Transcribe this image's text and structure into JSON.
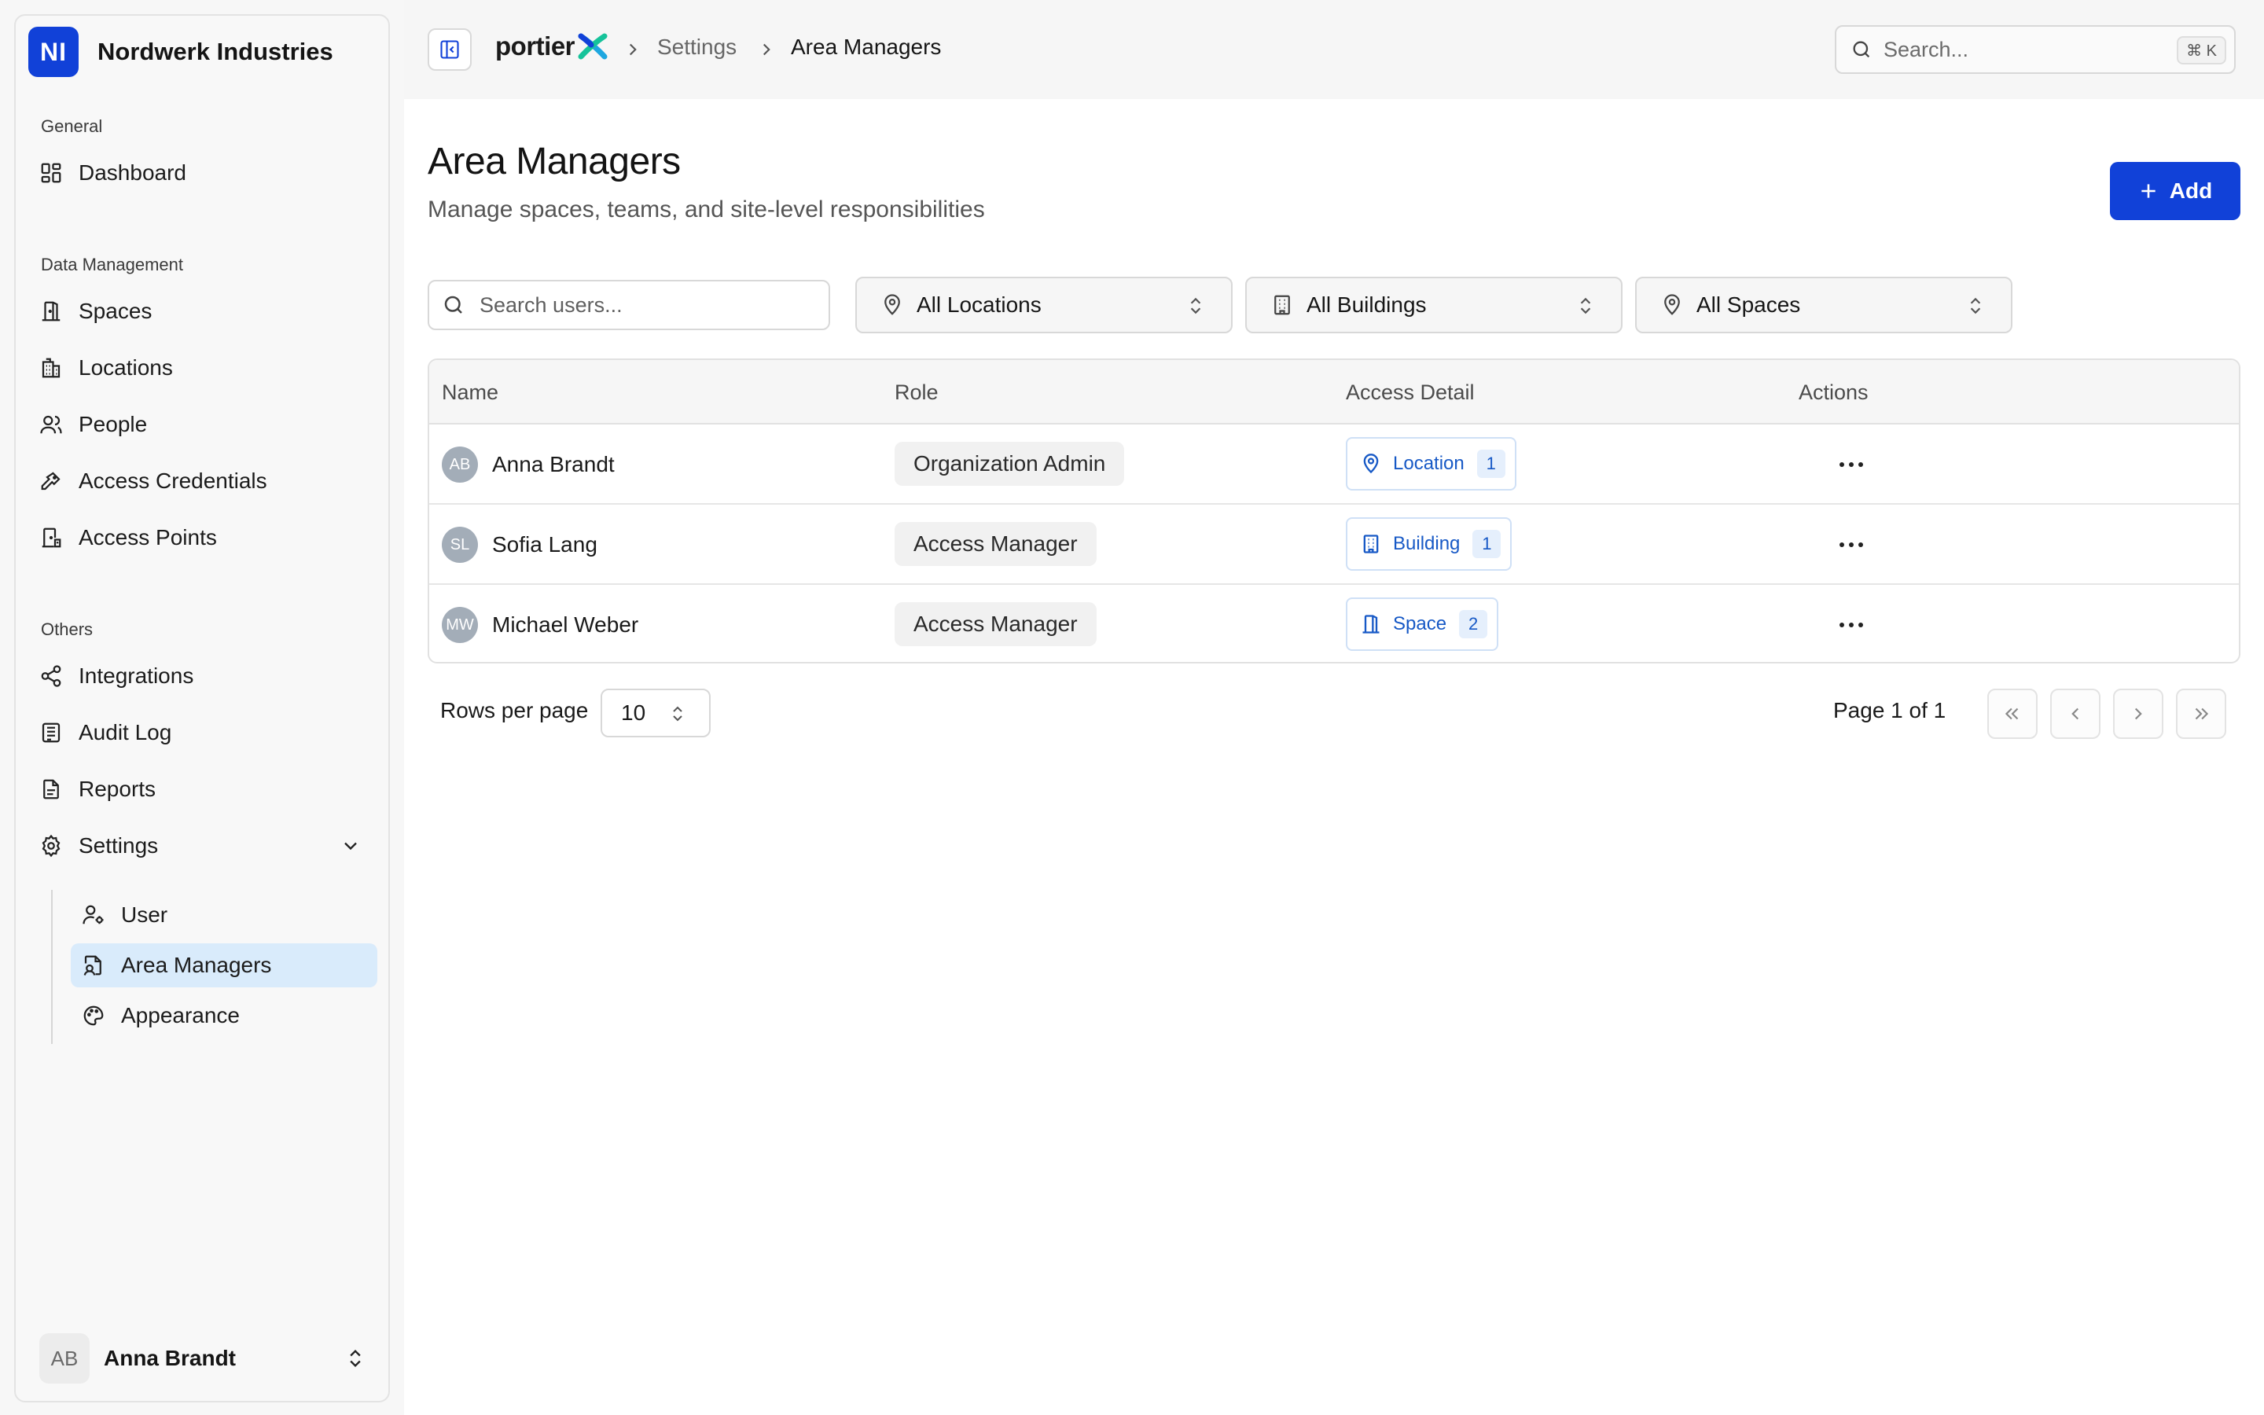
{
  "org": {
    "initials": "NI",
    "name": "Nordwerk Industries"
  },
  "sidebar": {
    "sections": [
      {
        "label": "General"
      },
      {
        "label": "Data Management"
      },
      {
        "label": "Others"
      }
    ],
    "general": [
      {
        "label": "Dashboard",
        "icon": "dashboard-icon"
      }
    ],
    "data_management": [
      {
        "label": "Spaces",
        "icon": "door-icon"
      },
      {
        "label": "Locations",
        "icon": "building-icon"
      },
      {
        "label": "People",
        "icon": "people-icon"
      },
      {
        "label": "Access Credentials",
        "icon": "key-icon"
      },
      {
        "label": "Access Points",
        "icon": "access-point-icon"
      }
    ],
    "others": [
      {
        "label": "Integrations",
        "icon": "share-icon"
      },
      {
        "label": "Audit Log",
        "icon": "log-icon"
      },
      {
        "label": "Reports",
        "icon": "report-icon"
      },
      {
        "label": "Settings",
        "icon": "gear-icon"
      }
    ],
    "settings_sub": [
      {
        "label": "User",
        "icon": "user-cog-icon"
      },
      {
        "label": "Area Managers",
        "icon": "area-manager-icon",
        "active": true
      },
      {
        "label": "Appearance",
        "icon": "palette-icon"
      }
    ],
    "current_user": {
      "initials": "AB",
      "name": "Anna Brandt"
    }
  },
  "topbar": {
    "brand": "portier",
    "breadcrumbs": [
      "Settings",
      "Area Managers"
    ],
    "search_placeholder": "Search...",
    "shortcut": "⌘ K"
  },
  "page": {
    "title": "Area Managers",
    "subtitle": "Manage spaces, teams, and site-level responsibilities",
    "add_label": "Add"
  },
  "filters": {
    "search_placeholder": "Search users...",
    "locations": "All Locations",
    "buildings": "All Buildings",
    "spaces": "All Spaces"
  },
  "table": {
    "columns": [
      "Name",
      "Role",
      "Access Detail",
      "Actions"
    ],
    "rows": [
      {
        "initials": "AB",
        "name": "Anna Brandt",
        "role": "Organization Admin",
        "access_type": "Location",
        "access_count": "1",
        "access_icon": "pin-icon"
      },
      {
        "initials": "SL",
        "name": "Sofia Lang",
        "role": "Access Manager",
        "access_type": "Building",
        "access_count": "1",
        "access_icon": "building-icon"
      },
      {
        "initials": "MW",
        "name": "Michael Weber",
        "role": "Access Manager",
        "access_type": "Space",
        "access_count": "2",
        "access_icon": "door-icon"
      }
    ]
  },
  "pagination": {
    "rows_per_page_label": "Rows per page",
    "rows_per_page": "10",
    "page_info": "Page 1 of 1"
  },
  "colors": {
    "accent": "#1141d8",
    "active_nav": "#d9ebfb",
    "access_link": "#1759c6"
  }
}
